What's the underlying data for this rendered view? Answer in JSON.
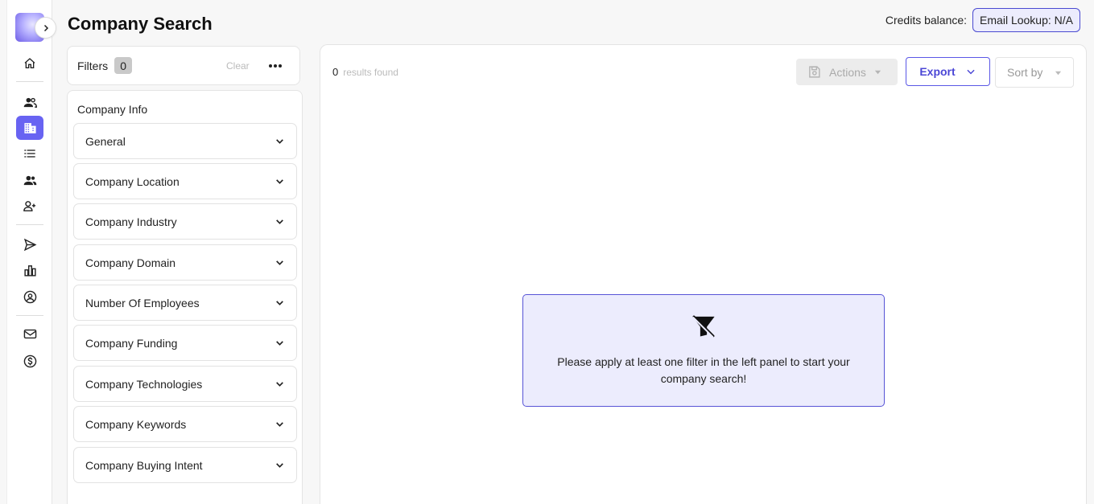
{
  "header": {
    "title": "Company Search",
    "credits_label": "Credits balance:",
    "email_lookup": "Email Lookup: N/A"
  },
  "sidebar": {
    "items": [
      {
        "icon": "home-icon",
        "active": false
      },
      {
        "icon": "people-icon",
        "active": false
      },
      {
        "icon": "building-icon",
        "active": true
      },
      {
        "icon": "list-icon",
        "active": false
      },
      {
        "icon": "team-icon",
        "active": false
      },
      {
        "icon": "add-person-icon",
        "active": false
      },
      {
        "icon": "send-icon",
        "active": false
      },
      {
        "icon": "bar-chart-icon",
        "active": false
      },
      {
        "icon": "user-circle-icon",
        "active": false
      },
      {
        "icon": "mail-icon",
        "active": false
      },
      {
        "icon": "dollar-icon",
        "active": false
      }
    ],
    "accent_color": "#6863f2"
  },
  "filters": {
    "label": "Filters",
    "count": "0",
    "clear_label": "Clear",
    "section_title": "Company Info",
    "items": [
      {
        "label": "General"
      },
      {
        "label": "Company Location"
      },
      {
        "label": "Company Industry"
      },
      {
        "label": "Company Domain"
      },
      {
        "label": "Number Of Employees"
      },
      {
        "label": "Company Funding"
      },
      {
        "label": "Company Technologies"
      },
      {
        "label": "Company Keywords"
      },
      {
        "label": "Company Buying Intent"
      }
    ]
  },
  "results": {
    "count": "0",
    "count_label": "results found",
    "actions_label": "Actions",
    "export_label": "Export",
    "sort_label": "Sort by",
    "empty_message": "Please apply at least one filter in the left panel to start your company search!"
  }
}
